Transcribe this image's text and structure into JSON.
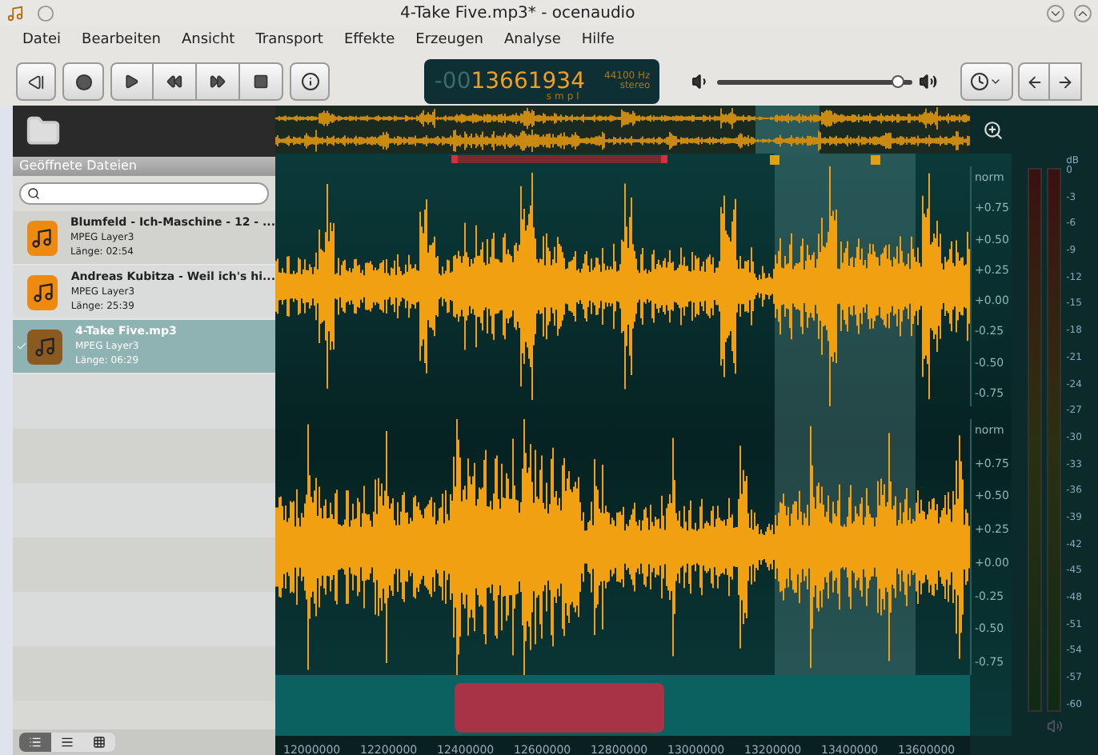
{
  "window": {
    "title": "4-Take Five.mp3* - ocenaudio"
  },
  "menu": [
    "Datei",
    "Bearbeiten",
    "Ansicht",
    "Transport",
    "Effekte",
    "Erzeugen",
    "Analyse",
    "Hilfe"
  ],
  "counter": {
    "prefix": "-00",
    "value": "13661934",
    "rate": "44100 Hz",
    "channels": "stereo",
    "unit": "smpl"
  },
  "volume": {
    "level": 0.93
  },
  "sidebar": {
    "title": "Geöffnete Dateien",
    "files": [
      {
        "name": "Blumfeld - Ich-Maschine - 12 - ...",
        "format": "MPEG Layer3",
        "length": "Länge: 02:54",
        "selected": false
      },
      {
        "name": "Andreas Kubitza - Weil ich's hi...",
        "format": "MPEG Layer3",
        "length": "Länge: 25:39",
        "selected": false
      },
      {
        "name": "4-Take Five.mp3",
        "format": "MPEG Layer3",
        "length": "Länge: 06:29",
        "selected": true
      }
    ]
  },
  "channels": [
    {
      "scale": [
        "norm",
        "+0.75",
        "+0.50",
        "+0.25",
        "+0.00",
        "-0.25",
        "-0.50",
        "-0.75"
      ]
    },
    {
      "scale": [
        "norm",
        "+0.75",
        "+0.50",
        "+0.25",
        "+0.00",
        "-0.25",
        "-0.50",
        "-0.75"
      ]
    }
  ],
  "meter": {
    "unit": "dB",
    "ticks": [
      "0",
      "-3",
      "-6",
      "-9",
      "-12",
      "-15",
      "-18",
      "-21",
      "-24",
      "-27",
      "-30",
      "-33",
      "-36",
      "-39",
      "-42",
      "-45",
      "-48",
      "-51",
      "-54",
      "-57",
      "-60"
    ]
  },
  "ruler": [
    "12000000",
    "12200000",
    "12400000",
    "12600000",
    "12800000",
    "13000000",
    "13200000",
    "13400000",
    "13600000"
  ]
}
